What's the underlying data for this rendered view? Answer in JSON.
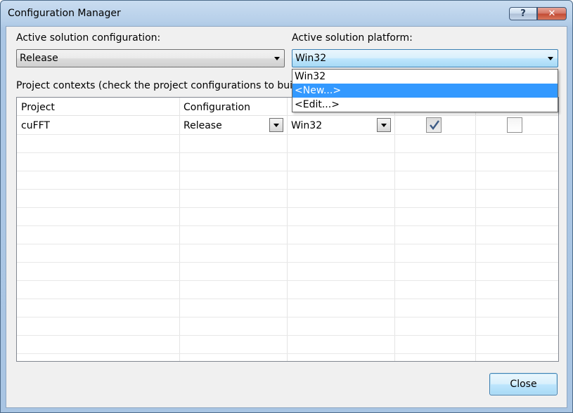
{
  "window": {
    "title": "Configuration Manager",
    "help_label": "?",
    "close_label": "✕"
  },
  "active_config": {
    "label": "Active solution configuration:",
    "value": "Release"
  },
  "active_platform": {
    "label": "Active solution platform:",
    "value": "Win32",
    "options": [
      "Win32",
      "<New...>",
      "<Edit...>"
    ],
    "highlighted": "<New...>"
  },
  "project_contexts": {
    "label": "Project contexts (check the project configurations to build c"
  },
  "grid": {
    "columns": [
      "Project",
      "Configuration"
    ],
    "rows": [
      {
        "project": "cuFFT",
        "configuration": "Release",
        "platform": "Win32",
        "build": true,
        "deploy": false
      }
    ]
  },
  "footer": {
    "close_button": "Close"
  },
  "colors": {
    "selection": "#3399ff",
    "focus_border": "#3c7fb1"
  },
  "icons": {
    "check": "check-icon",
    "dropdown": "chevron-down-icon"
  }
}
